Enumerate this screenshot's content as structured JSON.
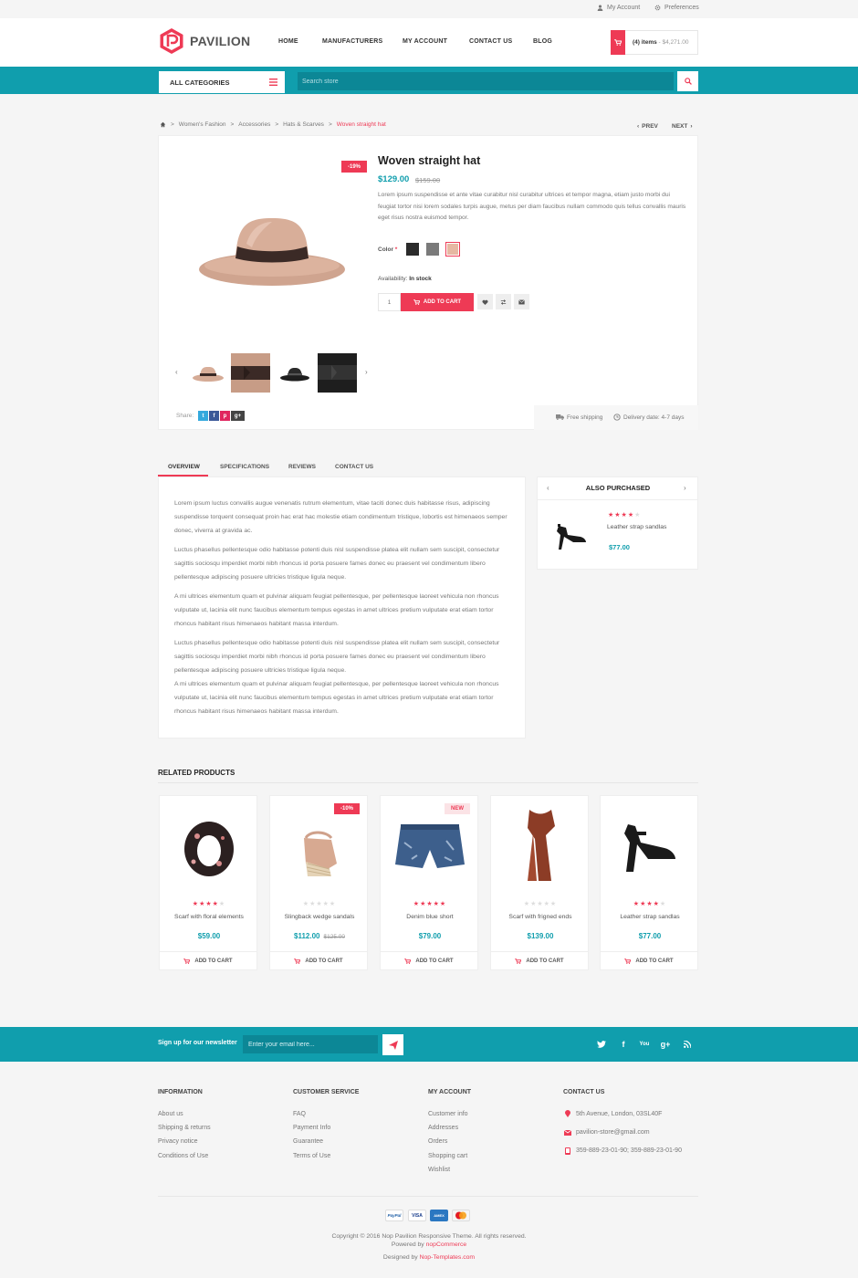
{
  "topbar": {
    "my_account": "My Account",
    "preferences": "Preferences"
  },
  "logo": {
    "text": "PAVILION"
  },
  "nav": [
    "HOME",
    "MANUFACTURERS",
    "MY ACCOUNT",
    "CONTACT US",
    "BLOG"
  ],
  "cart": {
    "items": "(4) items",
    "total": "- $4,271.00"
  },
  "categories": {
    "label": "ALL CATEGORIES"
  },
  "search": {
    "placeholder": "Search store"
  },
  "breadcrumb": [
    "Women's Fashion",
    "Accessories",
    "Hats & Scarves",
    "Woven straight hat"
  ],
  "pager": {
    "prev": "PREV",
    "next": "NEXT"
  },
  "product": {
    "discount": "-19%",
    "title": "Woven straight hat",
    "price": "$129.00",
    "old_price": "$159.00",
    "description": "Lorem ipsum suspendisse et ante vitae curabitur nisl curabitur ultrices et tempor magna, etiam justo morbi dui feugiat tortor nisi lorem sodales turpis augue, metus per diam faucibus nullam commodo quis tellus convallis mauris eget risus nostra euismod tempor.",
    "color_label": "Color",
    "required_mark": "*",
    "colors": [
      "#2b2b2b",
      "#7a7a7a",
      "#e6b8a2"
    ],
    "availability_label": "Availability:",
    "availability_value": "In stock",
    "quantity": "1",
    "add_to_cart": "ADD TO CART",
    "share_label": "Share:",
    "share_icons": [
      "t",
      "f",
      "p",
      "g+"
    ],
    "free_shipping": "Free shipping",
    "delivery": "Delivery date: 4-7 days"
  },
  "tabs": [
    "OVERVIEW",
    "SPECIFICATIONS",
    "REVIEWS",
    "CONTACT US"
  ],
  "overview": [
    "Lorem ipsum luctus convallis augue venenatis rutrum elementum, vitae taciti donec duis habitasse risus, adipiscing suspendisse torquent consequat proin hac erat hac molestie etiam condimentum tristique, lobortis est himenaeos semper donec, viverra at gravida ac.",
    "Luctus phasellus pellentesque odio habitasse potenti duis nisl suspendisse platea elit nullam sem suscipit, consectetur sagittis sociosqu imperdiet morbi nibh rhoncus id porta posuere fames donec eu praesent vel condimentum libero pellentesque adipiscing posuere ultricies tristique ligula neque.",
    "A mi ultrices elementum quam et pulvinar aliquam feugiat pellentesque, per pellentesque laoreet vehicula non rhoncus vulputate ut, lacinia elit nunc faucibus elementum tempus egestas in amet ultrices pretium vulputate erat etiam tortor rhoncus habitant risus himenaeos habitant massa interdum.",
    "Luctus phasellus pellentesque odio habitasse potenti duis nisl suspendisse platea elit nullam sem suscipit, consectetur sagittis sociosqu imperdiet morbi nibh rhoncus id porta posuere fames donec eu praesent vel condimentum libero pellentesque adipiscing posuere ultricies tristique ligula neque.\nA mi ultrices elementum quam et pulvinar aliquam feugiat pellentesque, per pellentesque laoreet vehicula non rhoncus vulputate ut, lacinia elit nunc faucibus elementum tempus egestas in amet ultrices pretium vulputate erat etiam tortor rhoncus habitant risus himenaeos habitant massa interdum."
  ],
  "also_purchased": {
    "title": "ALSO PURCHASED",
    "name": "Leather strap sandlas",
    "price": "$77.00",
    "rating": 4
  },
  "related": {
    "title": "RELATED PRODUCTS",
    "add_to_cart": "ADD TO CART",
    "items": [
      {
        "name": "Scarf with floral elements",
        "price": "$59.00",
        "old_price": "",
        "rating": 4,
        "badge": ""
      },
      {
        "name": "Slingback wedge sandals",
        "price": "$112.00",
        "old_price": "$125.00",
        "rating": 0,
        "badge": "-10%"
      },
      {
        "name": "Denim blue short",
        "price": "$79.00",
        "old_price": "",
        "rating": 5,
        "badge": "NEW"
      },
      {
        "name": "Scarf with frigned ends",
        "price": "$139.00",
        "old_price": "",
        "rating": 0,
        "badge": ""
      },
      {
        "name": "Leather strap sandlas",
        "price": "$77.00",
        "old_price": "",
        "rating": 4,
        "badge": ""
      }
    ]
  },
  "newsletter": {
    "label": "Sign up for our newsletter",
    "placeholder": "Enter your email here..."
  },
  "social": [
    "twitter-icon",
    "facebook-icon",
    "youtube-icon",
    "googleplus-icon",
    "rss-icon"
  ],
  "footer": {
    "information": {
      "title": "INFORMATION",
      "links": [
        "About us",
        "Shipping & returns",
        "Privacy notice",
        "Conditions of Use"
      ]
    },
    "customer_service": {
      "title": "CUSTOMER SERVICE",
      "links": [
        "FAQ",
        "Payment Info",
        "Guarantee",
        "Terms of Use"
      ]
    },
    "my_account": {
      "title": "MY ACCOUNT",
      "links": [
        "Customer info",
        "Addresses",
        "Orders",
        "Shopping cart",
        "Wishlist"
      ]
    },
    "contact": {
      "title": "CONTACT US",
      "address": "5th Avenue, London, 03SL40F",
      "email": "pavilion-store@gmail.com",
      "phone": "359-889-23-01-90; 359-889-23-01-90"
    },
    "payments": [
      "PayPal",
      "VISA",
      "AMEX",
      "MC"
    ],
    "copyright": "Copyright © 2016 Nop Pavilion Responsive Theme. All rights reserved.",
    "powered_prefix": "Powered by",
    "powered_link": "nopCommerce",
    "designed_prefix": "Designed by",
    "designed_link": "Nop-Templates.com"
  },
  "colors": {
    "accent": "#ee3a55",
    "teal": "#109ead"
  }
}
